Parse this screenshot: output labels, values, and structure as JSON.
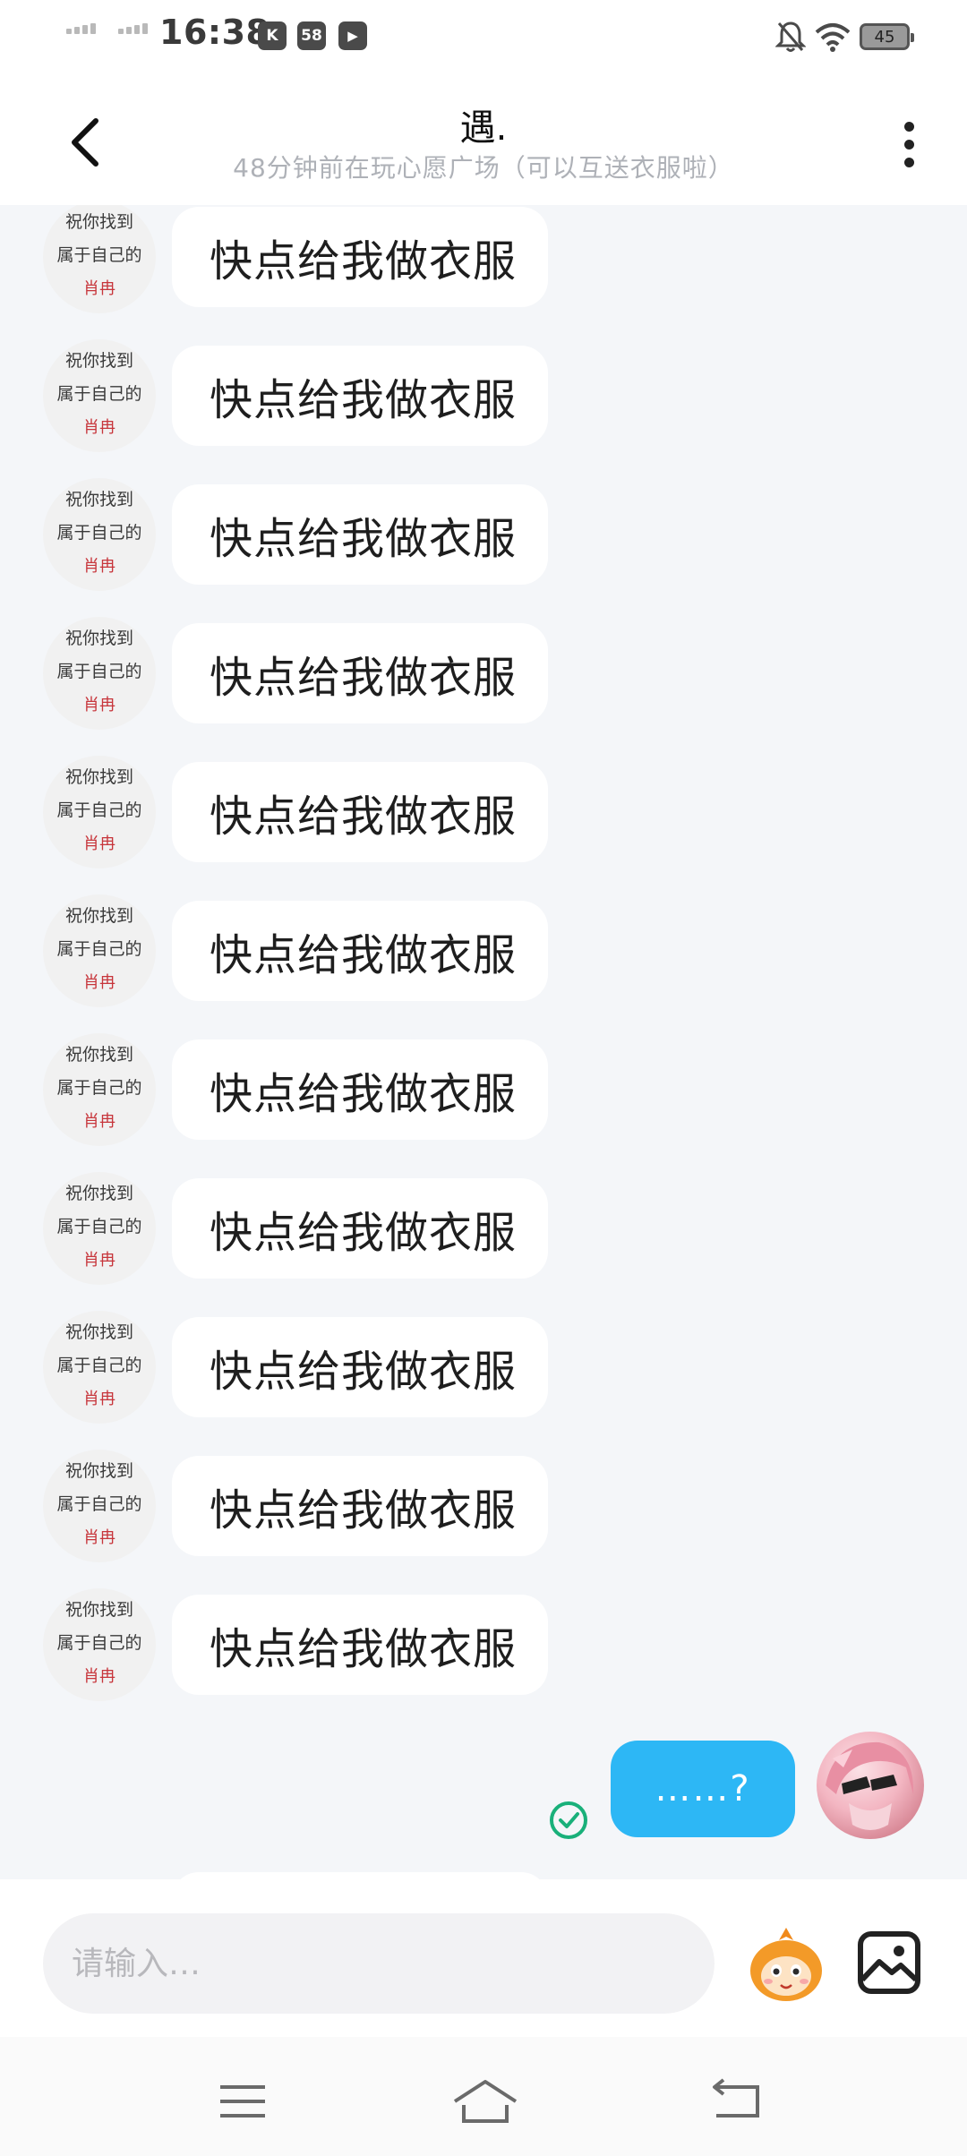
{
  "status_bar": {
    "time": "16:38",
    "notif_badges": [
      "K",
      "58",
      "▶"
    ],
    "battery": "45"
  },
  "header": {
    "title": "遇.",
    "subtitle": "48分钟前在玩心愿广场（可以互送衣服啦）"
  },
  "incoming_avatar": {
    "line1": "祝你找到",
    "line2": "属于自己的",
    "line3": "肖冉"
  },
  "messages": [
    {
      "text": "快点给我做衣服"
    },
    {
      "text": "快点给我做衣服"
    },
    {
      "text": "快点给我做衣服"
    },
    {
      "text": "快点给我做衣服"
    },
    {
      "text": "快点给我做衣服"
    },
    {
      "text": "快点给我做衣服"
    },
    {
      "text": "快点给我做衣服"
    },
    {
      "text": "快点给我做衣服"
    },
    {
      "text": "快点给我做衣服"
    },
    {
      "text": "快点给我做衣服"
    },
    {
      "text": "快点给我做衣服"
    }
  ],
  "outgoing": {
    "text": "……?",
    "status": "read"
  },
  "input": {
    "placeholder": "请输入…"
  },
  "colors": {
    "accent": "#2db7f5",
    "check": "#19b07a",
    "avatar_red": "#c7353b"
  }
}
